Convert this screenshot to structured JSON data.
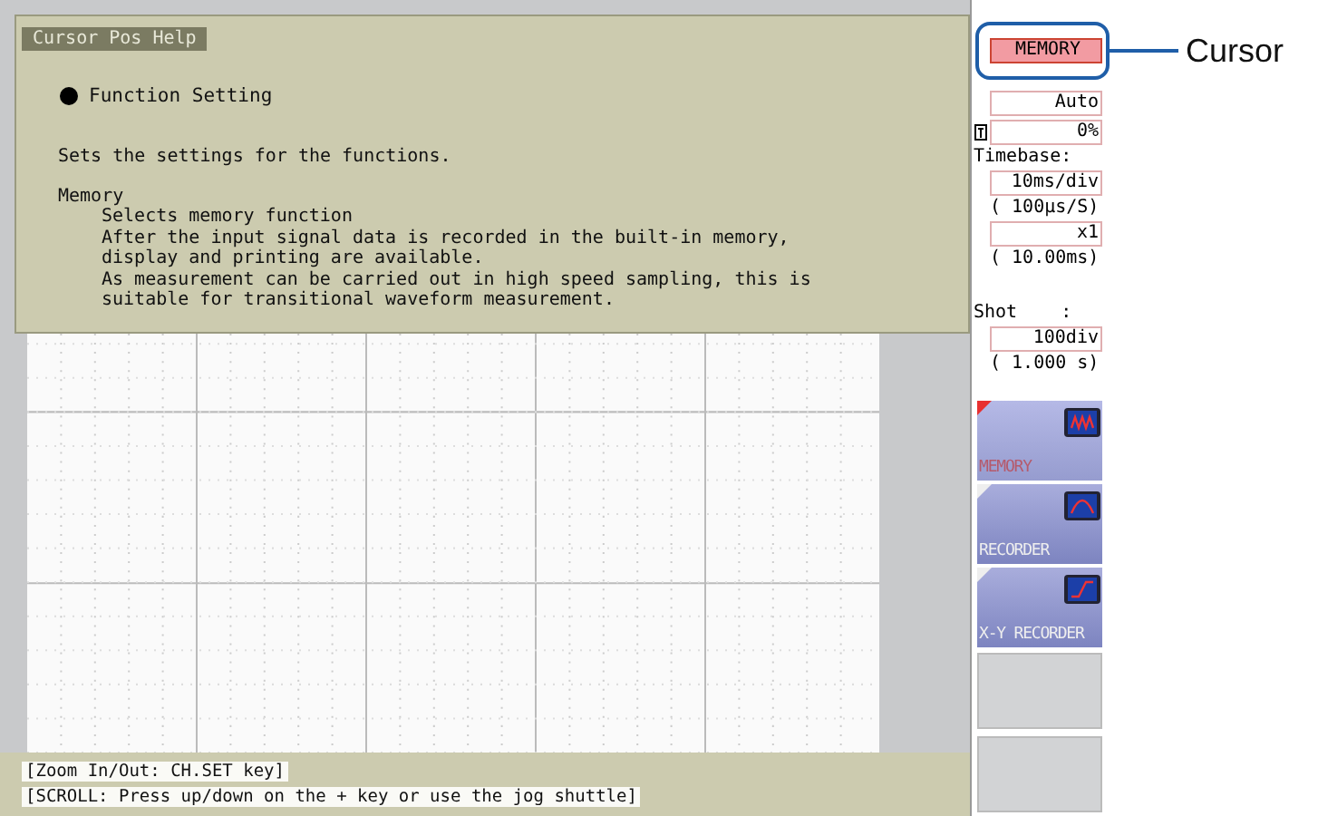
{
  "help": {
    "title": "Cursor Pos Help",
    "heading": "Function Setting",
    "lines": [
      {
        "kind": "text",
        "text": "Sets the settings for the functions."
      },
      {
        "kind": "gap"
      },
      {
        "kind": "text",
        "text": "Memory"
      },
      {
        "kind": "indent",
        "text": "Selects memory function"
      },
      {
        "kind": "indent",
        "text": "After the input signal data is recorded in the built-in memory,"
      },
      {
        "kind": "indent",
        "text": "display and printing are available."
      },
      {
        "kind": "indent",
        "text": "As measurement can be carried out in high speed sampling, this is"
      },
      {
        "kind": "indent",
        "text": "suitable for transitional waveform measurement."
      }
    ]
  },
  "settings": [
    {
      "kind": "highlight",
      "text": "MEMORY"
    },
    {
      "kind": "field",
      "text": "Auto"
    },
    {
      "kind": "trigger-field",
      "text": "0%"
    },
    {
      "kind": "label",
      "text": "Timebase:"
    },
    {
      "kind": "field",
      "text": "10ms/div"
    },
    {
      "kind": "note",
      "text": "( 100µs/S)"
    },
    {
      "kind": "field",
      "text": "x1"
    },
    {
      "kind": "note",
      "text": "( 10.00ms)"
    },
    {
      "kind": "section-label",
      "text": "Shot    :"
    },
    {
      "kind": "field",
      "text": "100div"
    },
    {
      "kind": "note",
      "text": "( 1.000 s)"
    }
  ],
  "functions": [
    {
      "kind": "memory",
      "label": "MEMORY",
      "selected": true
    },
    {
      "kind": "recorder",
      "label": "RECORDER",
      "selected": false
    },
    {
      "kind": "xy",
      "label": "X-Y RECORDER",
      "selected": false
    }
  ],
  "hints": [
    "[Zoom In/Out: CH.SET key]",
    "[SCROLL: Press up/down on the + key or use the jog shuttle]"
  ],
  "callout": {
    "label": "Cursor"
  }
}
